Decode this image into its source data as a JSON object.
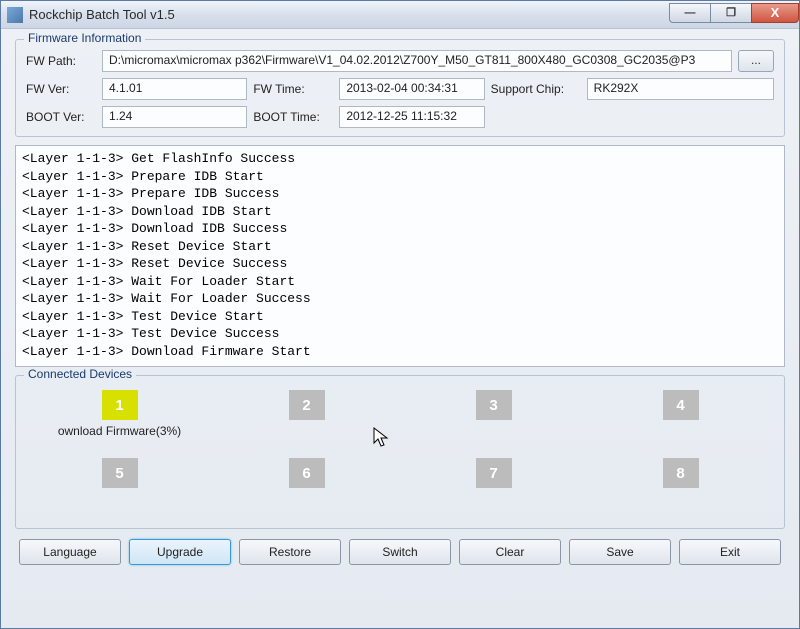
{
  "window": {
    "title": "Rockchip Batch Tool v1.5",
    "controls": {
      "min": "—",
      "max": "❐",
      "close": "X"
    }
  },
  "firmware": {
    "group_label": "Firmware Information",
    "labels": {
      "fw_path": "FW Path:",
      "fw_ver": "FW Ver:",
      "fw_time": "FW Time:",
      "support_chip": "Support Chip:",
      "boot_ver": "BOOT Ver:",
      "boot_time": "BOOT Time:"
    },
    "values": {
      "fw_path": "D:\\micromax\\micromax p362\\Firmware\\V1_04.02.2012\\Z700Y_M50_GT811_800X480_GC0308_GC2035@P3",
      "fw_ver": "4.1.01",
      "fw_time": "2013-02-04 00:34:31",
      "support_chip": "RK292X",
      "boot_ver": "1.24",
      "boot_time": "2012-12-25 11:15:32"
    },
    "browse": "..."
  },
  "log_lines": [
    "<Layer 1-1-3> Get FlashInfo Success",
    "<Layer 1-1-3> Prepare IDB Start",
    "<Layer 1-1-3> Prepare IDB Success",
    "<Layer 1-1-3> Download IDB Start",
    "<Layer 1-1-3> Download IDB Success",
    "<Layer 1-1-3> Reset Device Start",
    "<Layer 1-1-3> Reset Device Success",
    "<Layer 1-1-3> Wait For Loader Start",
    "<Layer 1-1-3> Wait For Loader Success",
    "<Layer 1-1-3> Test Device Start",
    "<Layer 1-1-3> Test Device Success",
    "<Layer 1-1-3> Download Firmware Start"
  ],
  "devices": {
    "group_label": "Connected Devices",
    "slots": [
      {
        "num": "1",
        "active": true,
        "status": "ownload Firmware(3%)"
      },
      {
        "num": "2",
        "active": false,
        "status": ""
      },
      {
        "num": "3",
        "active": false,
        "status": ""
      },
      {
        "num": "4",
        "active": false,
        "status": ""
      },
      {
        "num": "5",
        "active": false,
        "status": ""
      },
      {
        "num": "6",
        "active": false,
        "status": ""
      },
      {
        "num": "7",
        "active": false,
        "status": ""
      },
      {
        "num": "8",
        "active": false,
        "status": ""
      }
    ]
  },
  "buttons": {
    "language": "Language",
    "upgrade": "Upgrade",
    "restore": "Restore",
    "switch": "Switch",
    "clear": "Clear",
    "save": "Save",
    "exit": "Exit"
  }
}
